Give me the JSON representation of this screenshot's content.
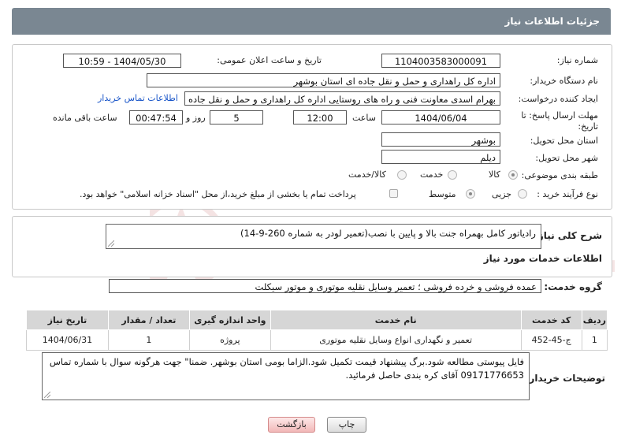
{
  "header": {
    "title": "جزئیات اطلاعات نیاز"
  },
  "fields": {
    "need_number_label": "شماره نیاز:",
    "need_number": "1104003583000091",
    "announce_label": "تاریخ و ساعت اعلان عمومی:",
    "announce_value": "1404/05/30 - 10:59",
    "buyer_org_label": "نام دستگاه خریدار:",
    "buyer_org": "اداره کل راهداری و حمل و نقل جاده ای استان بوشهر",
    "requester_label": "ایجاد کننده درخواست:",
    "requester": "بهرام اسدی معاونت فنی و راه های روستایی اداره کل راهداری و حمل و نقل جاده",
    "contact_link": "اطلاعات تماس خریدار",
    "deadline_label_1": "مهلت ارسال پاسخ: تا",
    "deadline_label_2": "تاریخ:",
    "deadline_date": "1404/06/04",
    "time_label": "ساعت",
    "deadline_time": "12:00",
    "days_value": "5",
    "days_label": "روز و",
    "remaining_time": "00:47:54",
    "remaining_label": "ساعت باقی مانده",
    "province_label": "استان محل تحویل:",
    "province": "بوشهر",
    "city_label": "شهر محل تحویل:",
    "city": "دیلم",
    "category_label": "طبقه بندی موضوعی:",
    "category_options": [
      "کالا",
      "خدمت",
      "کالا/خدمت"
    ],
    "process_label": "نوع فرآیند خرید :",
    "process_options": [
      "جزیی",
      "متوسط"
    ],
    "payment_note": "پرداخت تمام یا بخشی از مبلغ خرید،از محل \"اسناد خزانه اسلامی\" خواهد بود."
  },
  "description": {
    "label": "شرح کلی نیاز:",
    "text": "رادیاتور کامل بهمراه جنت بالا و پایین با نصب(تعمیر لودر به شماره 260-9-14)"
  },
  "services": {
    "section_title": "اطلاعات خدمات مورد نیاز",
    "group_label": "گروه خدمت:",
    "group_value": "عمده فروشی و خرده فروشی ؛ تعمیر وسایل نقلیه موتوری و موتور سیکلت",
    "table": {
      "headers": [
        "ردیف",
        "کد خدمت",
        "نام خدمت",
        "واحد اندازه گیری",
        "تعداد / مقدار",
        "تاریخ نیاز"
      ],
      "rows": [
        [
          "1",
          "ج-45-452",
          "تعمیر و نگهداری انواع وسایل نقلیه موتوری",
          "پروژه",
          "1",
          "1404/06/31"
        ]
      ]
    }
  },
  "buyer_notes": {
    "label": "توضیحات خریدار:",
    "text": "فایل پیوستی مطالعه شود.برگ پیشنهاد قیمت تکمیل شود.الزاما بومی استان بوشهر. ضمنا\" جهت هرگونه سوال با شماره تماس 09171776653 آقای کره بندی حاصل فرمائید."
  },
  "buttons": {
    "print": "چاپ",
    "back": "بازگشت"
  },
  "watermark": {
    "text": "AriaTender.neT"
  },
  "colors": {
    "header_bg": "#7a8792",
    "link": "#1a56c9",
    "back_button": "#f2b8b8",
    "table_header": "#d6d6d6"
  }
}
